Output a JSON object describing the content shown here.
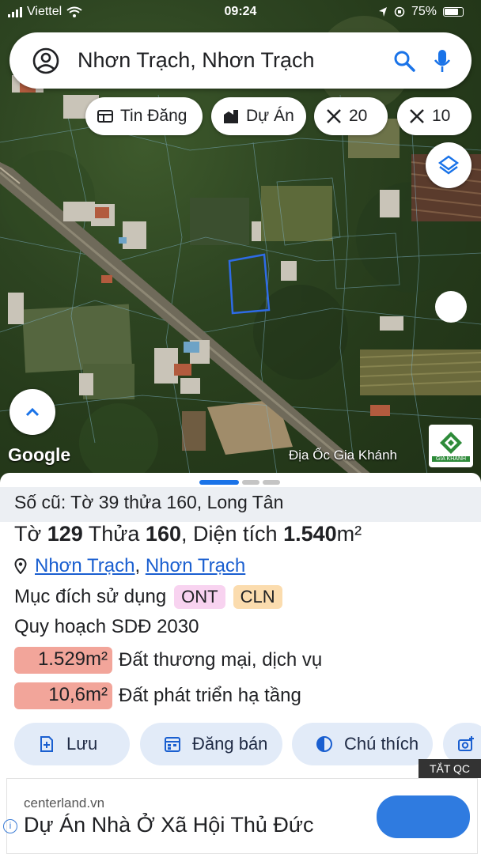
{
  "status_bar": {
    "carrier": "Viettel",
    "time": "09:24",
    "battery": "75%"
  },
  "search": {
    "query": "Nhơn Trạch, Nhơn Trạch"
  },
  "chips": [
    {
      "label": "Tin Đăng",
      "icon": "news-icon"
    },
    {
      "label": "Dự Án",
      "icon": "city-icon"
    },
    {
      "label": "20",
      "icon": "ruler-icon"
    },
    {
      "label": "10",
      "icon": "ruler-icon"
    }
  ],
  "map": {
    "attribution": "Google",
    "brand": "Địa Ốc Gia Khánh",
    "brand_logo_text": "GIA KHÁNH"
  },
  "parcel": {
    "old_ref": "Số cũ: Tờ 39 thửa 160, Long Tân",
    "to_label": "Tờ",
    "to_value": "129",
    "thua_label": "Thửa",
    "thua_value": "160",
    "area_label": "Diện tích",
    "area_value": "1.540",
    "area_unit": "m²",
    "location_parts": [
      "Nhơn Trạch",
      "Nhơn Trạch"
    ],
    "purpose_label": "Mục đích sử dụng",
    "purpose_tags": [
      {
        "label": "ONT",
        "color": "#f8d3f0"
      },
      {
        "label": "CLN",
        "color": "#fbdcae"
      }
    ],
    "plan_title": "Quy hoạch SDĐ 2030",
    "plan_items": [
      {
        "value": "1.529m²",
        "label": "Đất thương mại, dịch vụ",
        "color": "#f2a59a"
      },
      {
        "value": "10,6m²",
        "label": "Đất phát triển hạ tầng",
        "color": "#f2a59a"
      }
    ]
  },
  "actions": [
    {
      "label": "Lưu",
      "icon": "save-plus-icon"
    },
    {
      "label": "Đăng bán",
      "icon": "calendar-icon"
    },
    {
      "label": "Chú thích",
      "icon": "legend-icon"
    },
    {
      "label": "",
      "icon": "add-photo-icon"
    }
  ],
  "ad": {
    "close_label": "TẮT QC",
    "domain": "centerland.vn",
    "headline": "Dự Án Nhà Ở Xã Hội Thủ Đức"
  },
  "colors": {
    "accent_blue": "#1a73e8",
    "parcel_outline": "#2e6be6",
    "action_bg": "#e2ebf8"
  }
}
